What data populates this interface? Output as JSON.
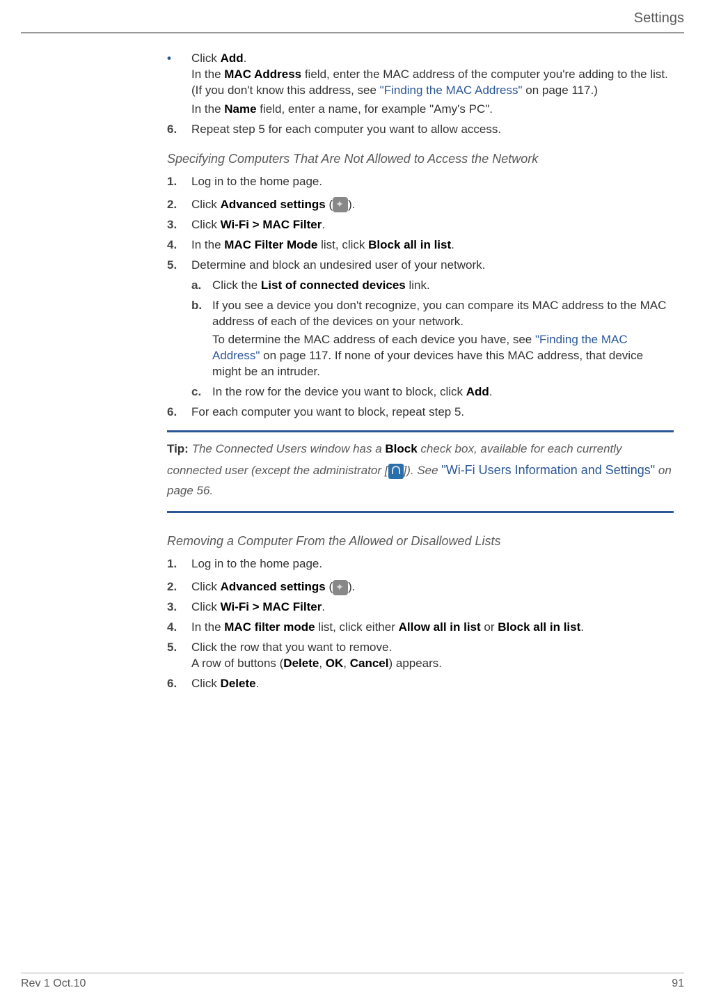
{
  "header": {
    "title": "Settings"
  },
  "section1": {
    "bullet": {
      "line1_a": "Click ",
      "line1_bold": "Add",
      "line1_b": ".",
      "para1_a": "In the ",
      "para1_bold": "MAC Address",
      "para1_b": " field, enter the MAC address of the computer you're adding to the list. (If you don't know this address, see ",
      "para1_link": "\"Finding the MAC Address\"",
      "para1_c": " on page 117.)",
      "para2_a": "In the ",
      "para2_bold": "Name",
      "para2_b": " field, enter a name, for example \"Amy's PC\"."
    },
    "step6": {
      "num": "6.",
      "text": "Repeat step 5 for each computer you want to allow access."
    }
  },
  "section2": {
    "heading": "Specifying Computers That Are Not Allowed to Access the Network",
    "step1": {
      "num": "1.",
      "text": "Log in to the home page."
    },
    "step2": {
      "num": "2.",
      "a": "Click ",
      "bold": "Advanced settings",
      "b": " (",
      "c": ")."
    },
    "step3": {
      "num": "3.",
      "a": "Click ",
      "bold": "Wi-Fi > MAC Filter",
      "b": "."
    },
    "step4": {
      "num": "4.",
      "a": "In the ",
      "bold1": "MAC Filter Mode",
      "b": " list, click ",
      "bold2": "Block all in list",
      "c": "."
    },
    "step5": {
      "num": "5.",
      "text": "Determine and block an undesired user of your network.",
      "sub_a": {
        "marker": "a.",
        "a": "Click the ",
        "bold": "List of connected devices",
        "b": " link."
      },
      "sub_b": {
        "marker": "b.",
        "para1": "If you see a device you don't recognize, you can compare its MAC address to the MAC address of each of the devices on your network.",
        "para2_a": "To determine the MAC address of each device you have, see ",
        "para2_link": "\"Finding the MAC Address\"",
        "para2_b": " on page 117. If none of your devices have this MAC address, that device might be an intruder."
      },
      "sub_c": {
        "marker": "c.",
        "a": "In the row for the device you want to block, click ",
        "bold": "Add",
        "b": "."
      }
    },
    "step6": {
      "num": "6.",
      "text": "For each computer you want to block, repeat step 5."
    }
  },
  "tip": {
    "label": "Tip: ",
    "a": "The Connected Users window has a ",
    "bold": "Block",
    "b": " check box, available for each currently connected user (except the administrator [",
    "c": "]). See ",
    "link": "\"Wi-Fi Users Information and Settings\"",
    "d": " on page 56."
  },
  "section3": {
    "heading": "Removing a Computer From the Allowed or Disallowed Lists",
    "step1": {
      "num": "1.",
      "text": "Log in to the home page."
    },
    "step2": {
      "num": "2.",
      "a": "Click ",
      "bold": "Advanced settings",
      "b": " (",
      "c": ")."
    },
    "step3": {
      "num": "3.",
      "a": "Click ",
      "bold": "Wi-Fi > MAC Filter",
      "b": "."
    },
    "step4": {
      "num": "4.",
      "a": "In the ",
      "bold1": "MAC filter mode",
      "b": " list, click either ",
      "bold2": "Allow all in list",
      "c": " or ",
      "bold3": "Block all in list",
      "d": "."
    },
    "step5": {
      "num": "5.",
      "text": "Click the row that you want to remove.",
      "para_a": "A row of buttons (",
      "para_b1": "Delete",
      "para_c": ", ",
      "para_b2": "OK",
      "para_d": ", ",
      "para_b3": "Cancel",
      "para_e": ") appears."
    },
    "step6": {
      "num": "6.",
      "a": "Click ",
      "bold": "Delete",
      "b": "."
    }
  },
  "footer": {
    "left": "Rev 1  Oct.10",
    "right": "91"
  }
}
